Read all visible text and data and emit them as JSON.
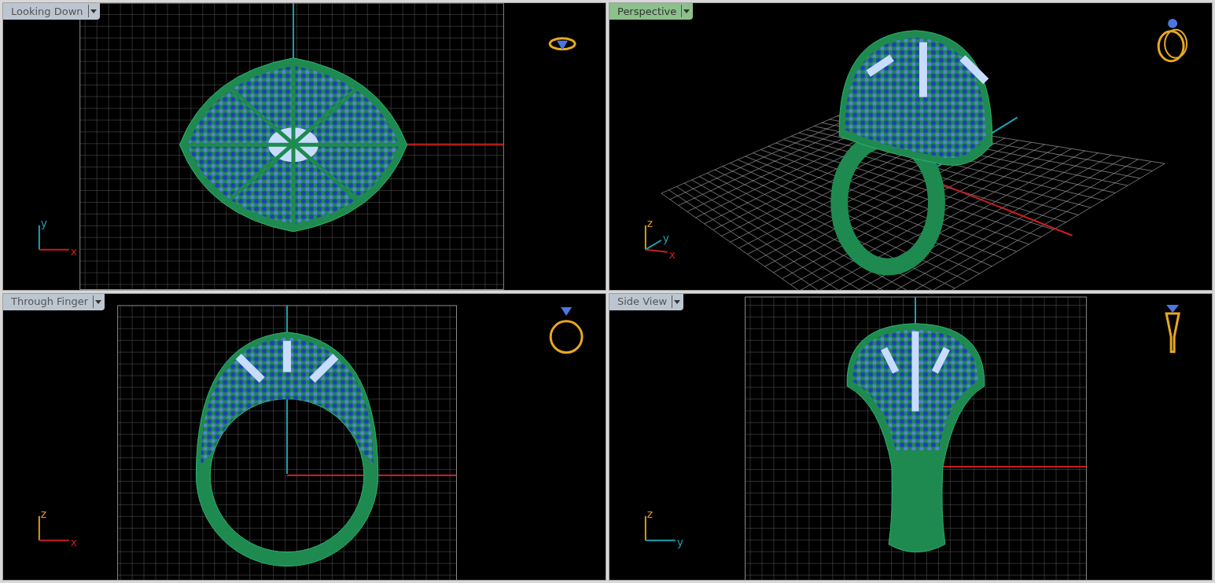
{
  "viewports": [
    {
      "kind": "top",
      "label": "Looking Down",
      "selected": false,
      "axes": [
        {
          "label": "y",
          "color": "#1fa0b0"
        },
        {
          "label": "x",
          "color": "#c81e1e"
        }
      ]
    },
    {
      "kind": "perspective",
      "label": "Perspective",
      "selected": true,
      "axes": [
        {
          "label": "z",
          "color": "#d99a1a"
        },
        {
          "label": "y",
          "color": "#1fa0b0"
        },
        {
          "label": "x",
          "color": "#c81e1e"
        }
      ]
    },
    {
      "kind": "front",
      "label": "Through Finger",
      "selected": false,
      "axes": [
        {
          "label": "z",
          "color": "#d99a1a"
        },
        {
          "label": "x",
          "color": "#c81e1e"
        }
      ]
    },
    {
      "kind": "side",
      "label": "Side View",
      "selected": false,
      "axes": [
        {
          "label": "z",
          "color": "#d99a1a"
        },
        {
          "label": "y",
          "color": "#1fa0b0"
        }
      ]
    }
  ]
}
